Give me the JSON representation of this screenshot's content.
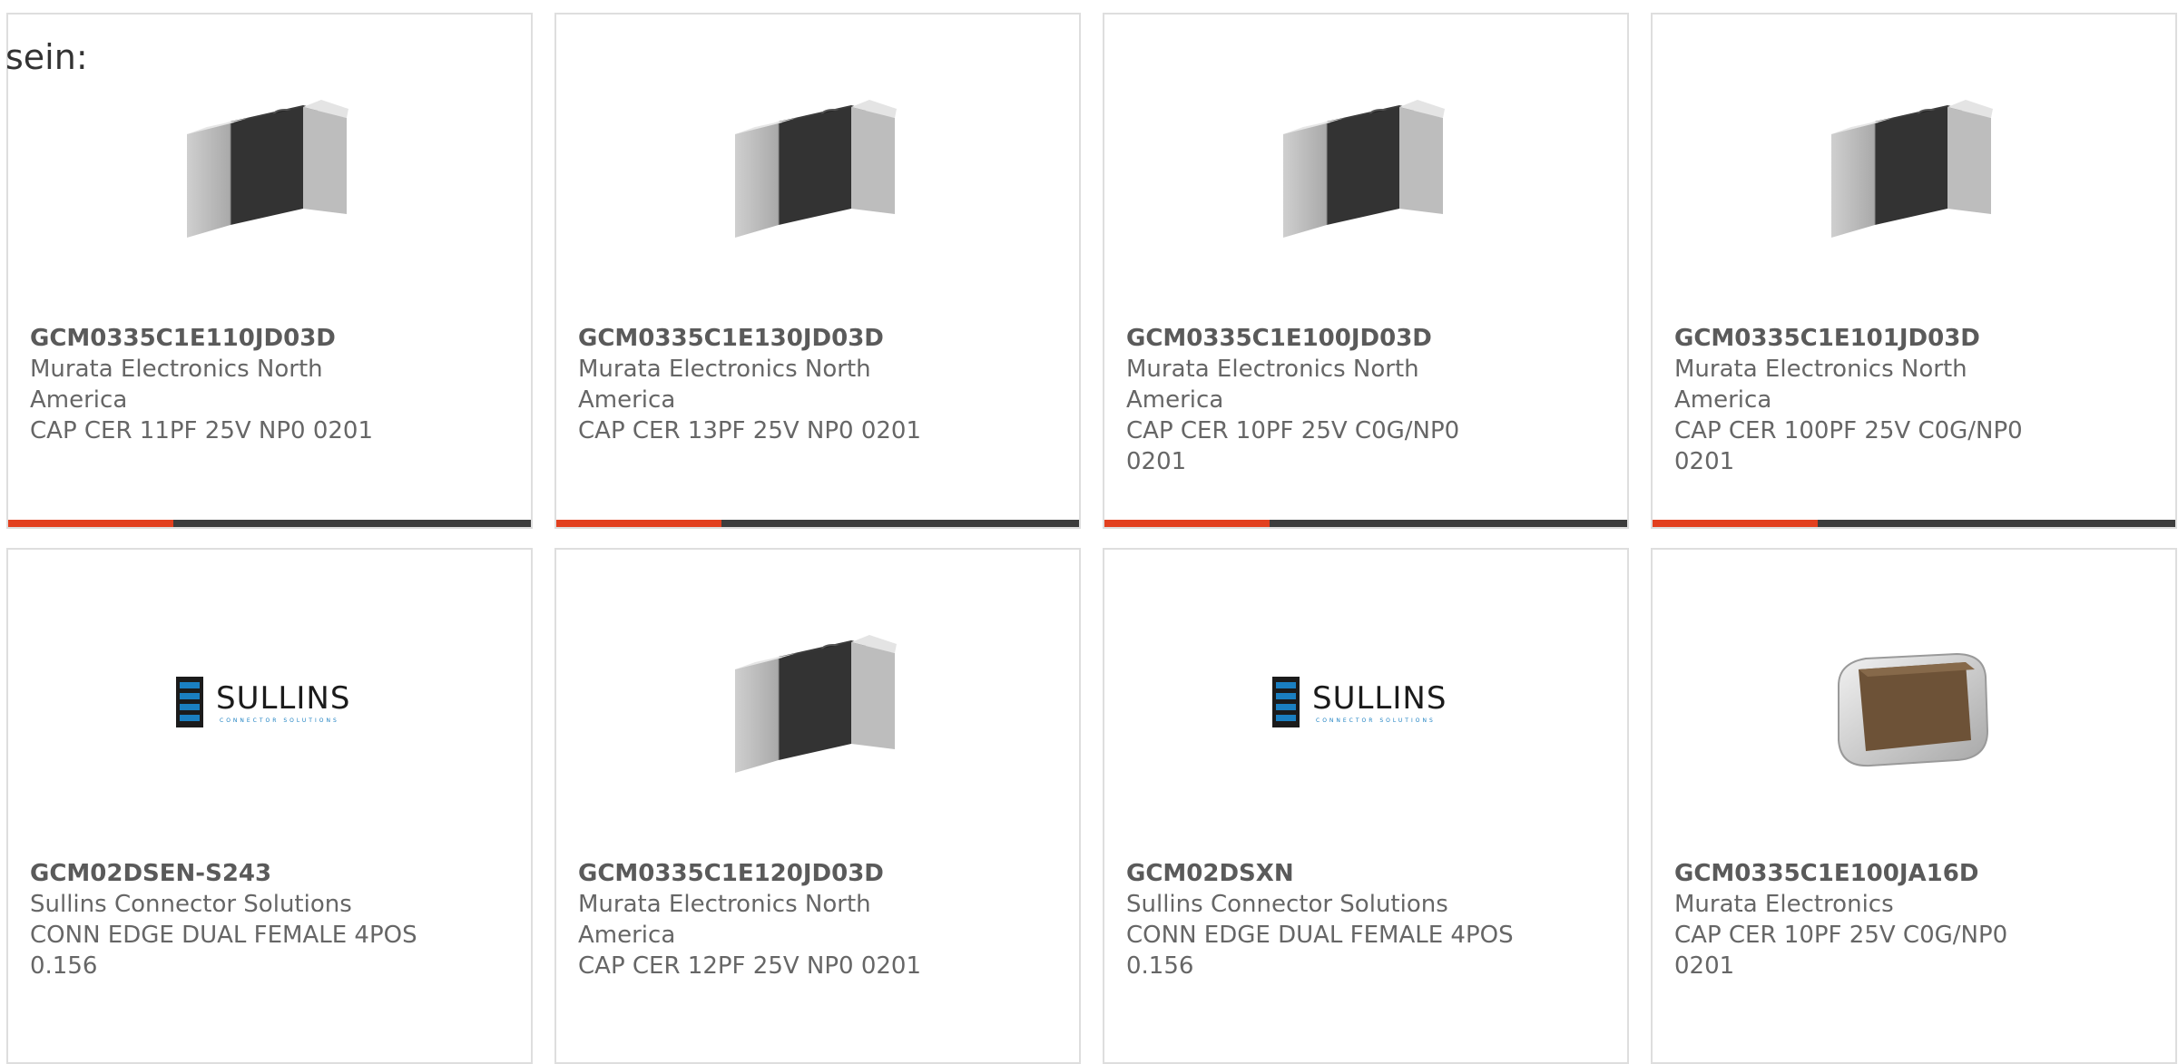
{
  "intro_text": "sein:",
  "products": [
    {
      "part_number": "GCM0335C1E110JD03D",
      "manufacturer": "Murata Electronics North America",
      "description": "CAP CER 11PF 25V NP0 0201",
      "image": "chip-capacitor-terminals-image",
      "has_bar": true
    },
    {
      "part_number": "GCM0335C1E130JD03D",
      "manufacturer": "Murata Electronics North America",
      "description": "CAP CER 13PF 25V NP0 0201",
      "image": "chip-capacitor-terminals-image",
      "has_bar": true
    },
    {
      "part_number": "GCM0335C1E100JD03D",
      "manufacturer": "Murata Electronics North America",
      "description": "CAP CER 10PF 25V C0G/NP0 0201",
      "image": "chip-capacitor-terminals-image",
      "has_bar": true
    },
    {
      "part_number": "GCM0335C1E101JD03D",
      "manufacturer": "Murata Electronics North America",
      "description": "CAP CER 100PF 25V C0G/NP0 0201",
      "image": "chip-capacitor-terminals-image",
      "has_bar": true
    },
    {
      "part_number": "GCM02DSEN-S243",
      "manufacturer": "Sullins Connector Solutions",
      "description": "CONN EDGE DUAL FEMALE 4POS 0.156",
      "image": "sullins-logo",
      "logo_text": "SULLINS",
      "logo_tagline": "CONNECTOR SOLUTIONS",
      "has_bar": false
    },
    {
      "part_number": "GCM0335C1E120JD03D",
      "manufacturer": "Murata Electronics North America",
      "description": "CAP CER 12PF 25V NP0 0201",
      "image": "chip-capacitor-terminals-image",
      "has_bar": false
    },
    {
      "part_number": "GCM02DSXN",
      "manufacturer": "Sullins Connector Solutions",
      "description": "CONN EDGE DUAL FEMALE 4POS 0.156",
      "image": "sullins-logo",
      "logo_text": "SULLINS",
      "logo_tagline": "CONNECTOR SOLUTIONS",
      "has_bar": false
    },
    {
      "part_number": "GCM0335C1E100JA16D",
      "manufacturer": "Murata Electronics",
      "description": "CAP CER 10PF 25V C0G/NP0 0201",
      "image": "chip-capacitor-brown-image",
      "has_bar": false
    }
  ],
  "colors": {
    "accent": "#e2401f",
    "bar": "#3d3d3d",
    "border": "#dedede",
    "text": "#666666",
    "sullins_blue": "#1a7fc1"
  }
}
